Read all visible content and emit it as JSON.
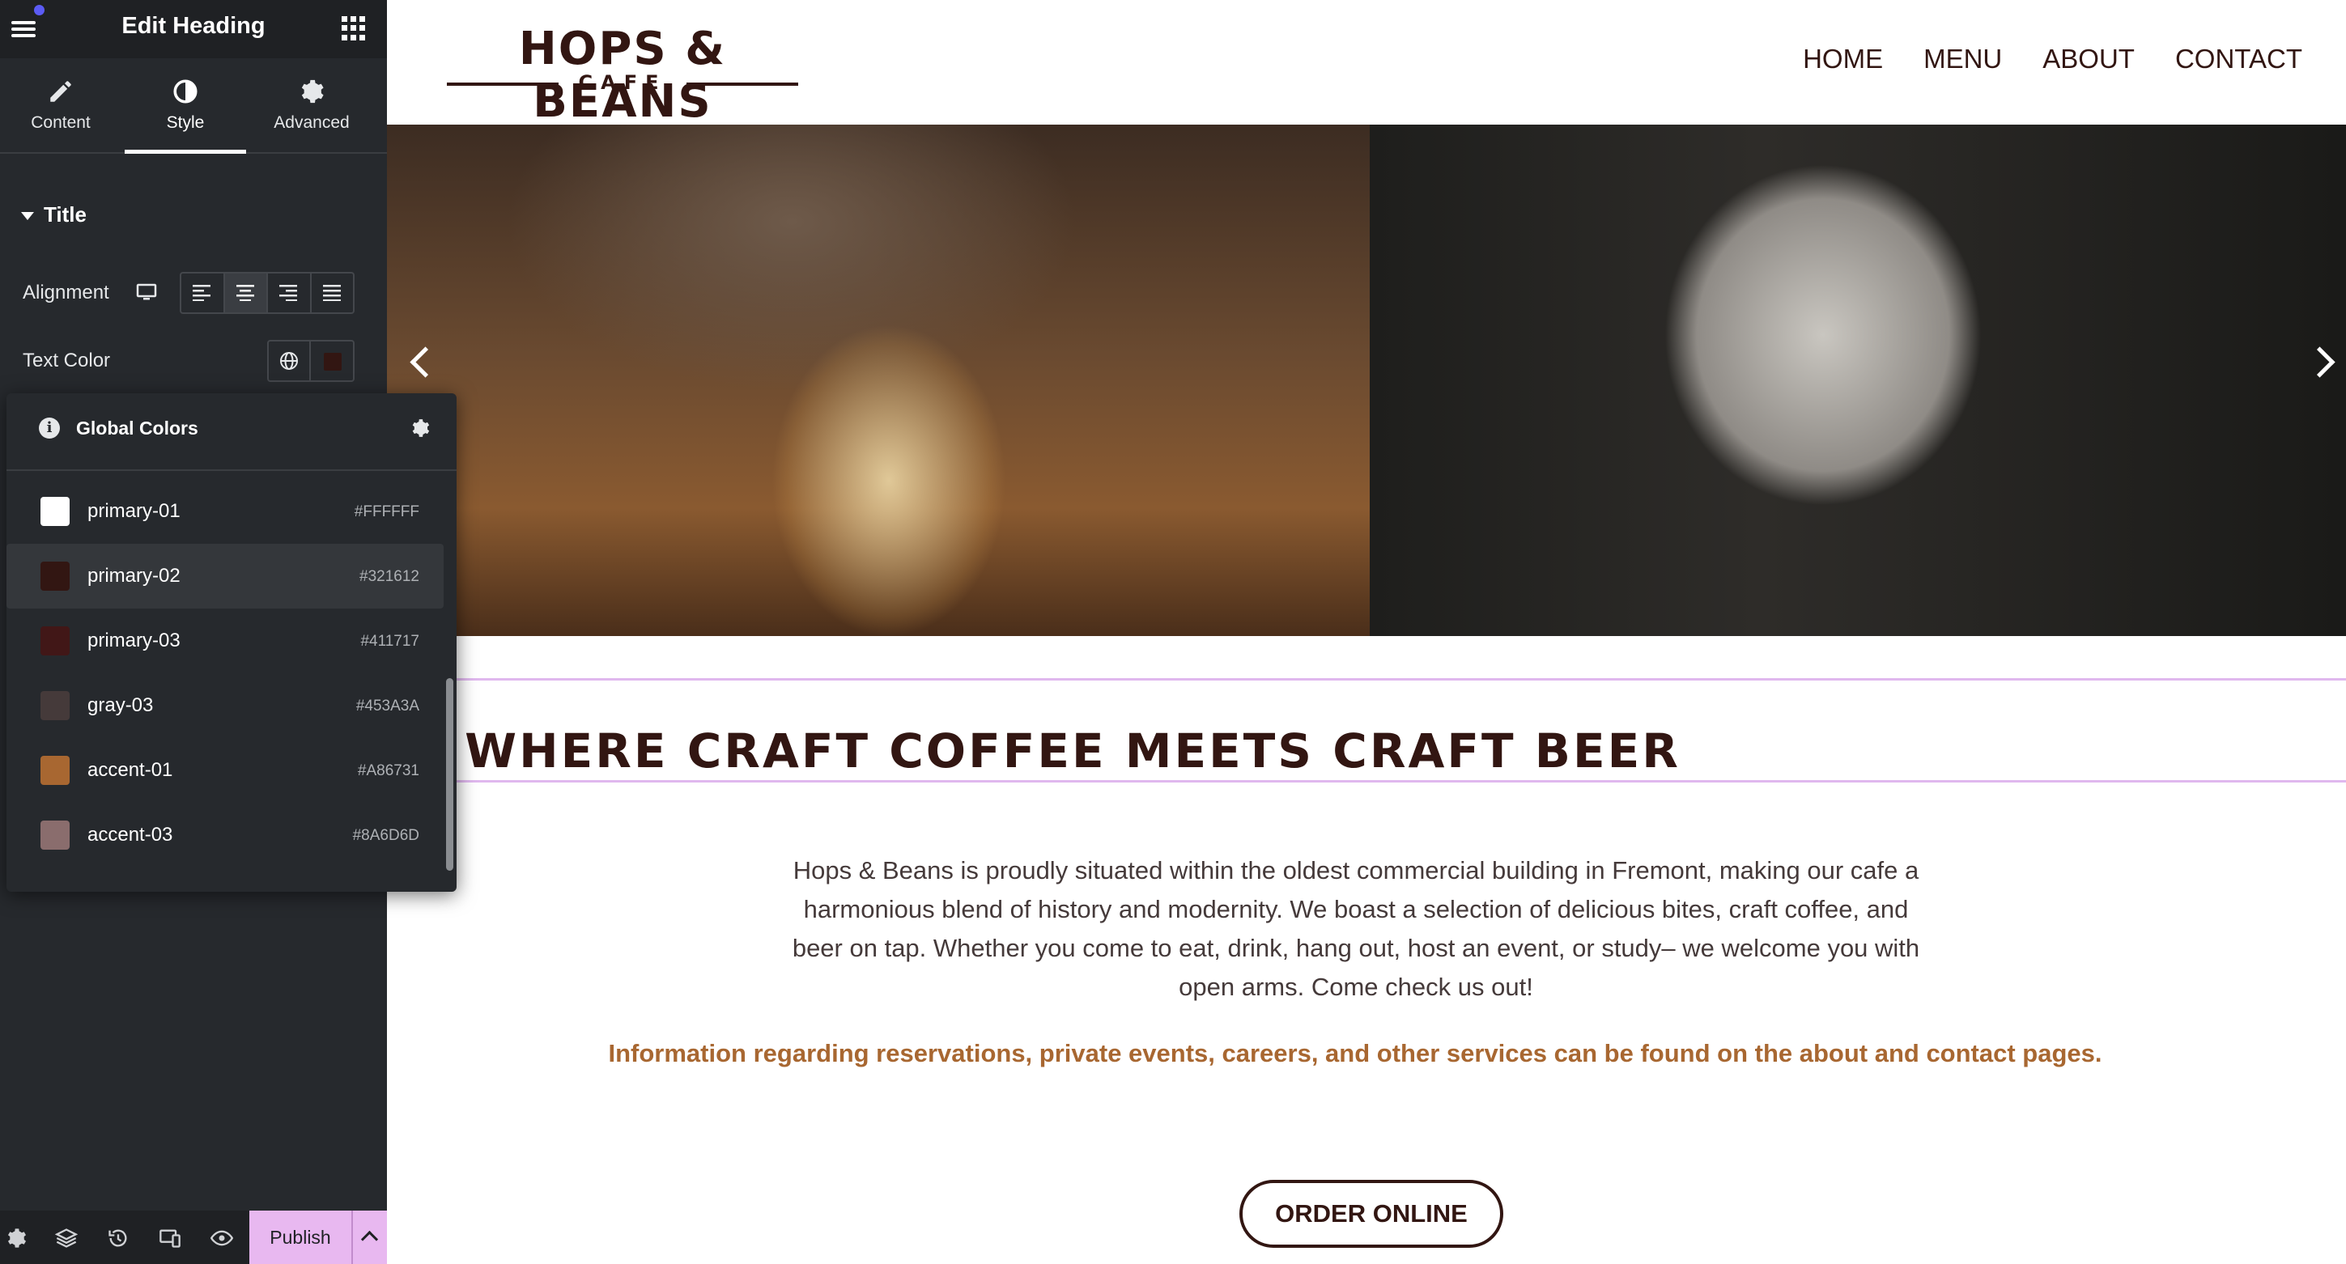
{
  "editor": {
    "title": "Edit Heading",
    "tabs": [
      {
        "label": "Content",
        "icon": "pencil-icon"
      },
      {
        "label": "Style",
        "icon": "half-circle-icon"
      },
      {
        "label": "Advanced",
        "icon": "gear-icon"
      }
    ],
    "active_tab": "Style",
    "section_title": "Title",
    "alignment_label": "Alignment",
    "alignment_options": [
      "left",
      "center",
      "right",
      "justify"
    ],
    "alignment_selected": "center",
    "text_color_label": "Text Color",
    "text_color_value": "#321612",
    "global_colors": {
      "title": "Global Colors",
      "items": [
        {
          "name": "primary-01",
          "hex": "#FFFFFF"
        },
        {
          "name": "primary-02",
          "hex": "#321612"
        },
        {
          "name": "primary-03",
          "hex": "#411717"
        },
        {
          "name": "gray-03",
          "hex": "#453A3A"
        },
        {
          "name": "accent-01",
          "hex": "#A86731"
        },
        {
          "name": "accent-03",
          "hex": "#8A6D6D"
        }
      ],
      "selected": "primary-02"
    },
    "footer": {
      "publish_label": "Publish",
      "icons": [
        "settings-icon",
        "layers-icon",
        "history-icon",
        "responsive-icon",
        "preview-eye-icon"
      ]
    }
  },
  "site": {
    "logo": {
      "main": "HOPS & BEANS",
      "sub": "CAFE"
    },
    "nav": [
      "HOME",
      "MENU",
      "ABOUT",
      "CONTACT"
    ],
    "heading": "WHERE CRAFT COFFEE MEETS CRAFT BEER",
    "intro": "Hops & Beans is proudly situated within the oldest commercial building in Fremont, making our cafe a harmonious blend of history and modernity. We boast a selection of delicious bites, craft coffee, and beer on tap. Whether you come to eat, drink, hang out, host an event, or study– we welcome you with open arms. Come check us out!",
    "info_note": "Information regarding reservations, private events, careers, and other services can be found on the about and contact pages.",
    "cta_label": "ORDER ONLINE",
    "colors": {
      "primary": "#321612",
      "accent": "#A86731",
      "body_text": "#453A3A"
    }
  }
}
